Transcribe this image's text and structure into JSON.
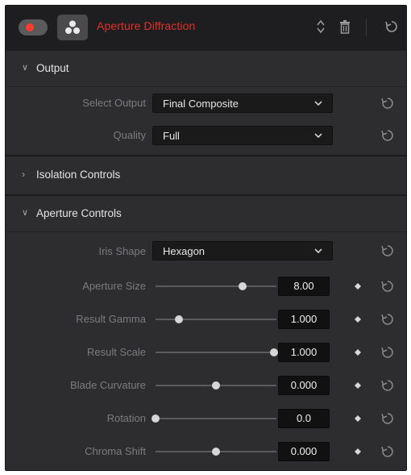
{
  "header": {
    "title": "Aperture Diffraction",
    "title_color": "#e0302c",
    "toggle_state": "on",
    "toggle_color": "#ff3b30",
    "icons": [
      "effect-icon",
      "up-down-arrows-icon",
      "trash-icon",
      "reset-icon"
    ]
  },
  "sections": {
    "output": {
      "label": "Output",
      "expanded": true,
      "select_output": {
        "label": "Select Output",
        "value": "Final Composite"
      },
      "quality": {
        "label": "Quality",
        "value": "Full"
      }
    },
    "isolation": {
      "label": "Isolation Controls",
      "expanded": false
    },
    "aperture": {
      "label": "Aperture Controls",
      "expanded": true,
      "iris_shape": {
        "label": "Iris Shape",
        "value": "Hexagon"
      },
      "sliders": [
        {
          "label": "Aperture Size",
          "value": "8.00",
          "position": 0.72
        },
        {
          "label": "Result Gamma",
          "value": "1.000",
          "position": 0.19
        },
        {
          "label": "Result Scale",
          "value": "1.000",
          "position": 0.98
        },
        {
          "label": "Blade Curvature",
          "value": "0.000",
          "position": 0.5
        },
        {
          "label": "Rotation",
          "value": "0.0",
          "position": 0.0
        },
        {
          "label": "Chroma Shift",
          "value": "0.000",
          "position": 0.5
        }
      ]
    }
  }
}
